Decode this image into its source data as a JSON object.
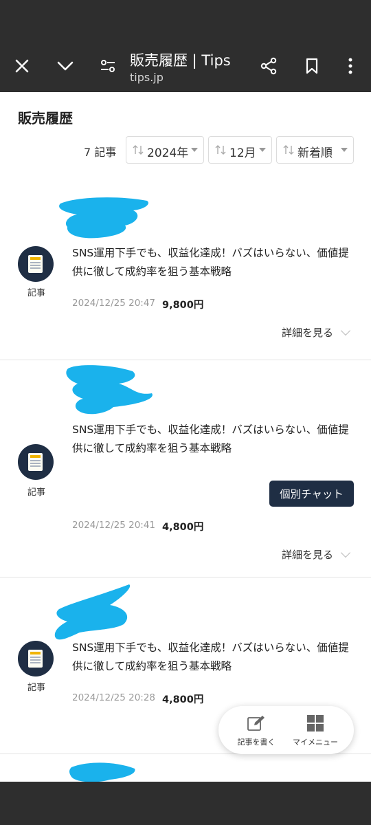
{
  "browser": {
    "title": "販売履歴 | Tips",
    "url": "tips.jp"
  },
  "page": {
    "heading": "販売履歴",
    "count": "7 記事",
    "filters": [
      {
        "label": "2024年"
      },
      {
        "label": "12月"
      },
      {
        "label": "新着順"
      }
    ]
  },
  "items": [
    {
      "type_label": "記事",
      "title": "SNS運用下手でも、収益化達成！バズはいらない、価値提供に徹して成約率を狙う基本戦略",
      "date": "2024/12/25 20:47",
      "price": "9,800円",
      "detail_label": "詳細を見る"
    },
    {
      "type_label": "記事",
      "title": "SNS運用下手でも、収益化達成！バズはいらない、価値提供に徹して成約率を狙う基本戦略",
      "chat_label": "個別チャット",
      "date": "2024/12/25 20:41",
      "price": "4,800円",
      "detail_label": "詳細を見る"
    },
    {
      "type_label": "記事",
      "title": "SNS運用下手でも、収益化達成！バズはいらない、価値提供に徹して成約率を狙う基本戦略",
      "date": "2024/12/25 20:28",
      "price": "4,800円"
    }
  ],
  "fab": {
    "write_label": "記事を書く",
    "menu_label": "マイメニュー"
  },
  "icons": {
    "close": "close-icon",
    "collapse": "chevron-down-icon",
    "settings": "sliders-icon",
    "share": "share-icon",
    "bookmark": "bookmark-icon",
    "more": "more-vertical-icon",
    "sort": "sort-icon",
    "article": "document-icon",
    "edit": "edit-icon",
    "grid": "grid-icon"
  },
  "colors": {
    "browser_bar": "#2e2e2e",
    "accent_navy": "#1f2e44",
    "redaction": "#1ab2ec",
    "muted_text": "#9a9a9a"
  }
}
